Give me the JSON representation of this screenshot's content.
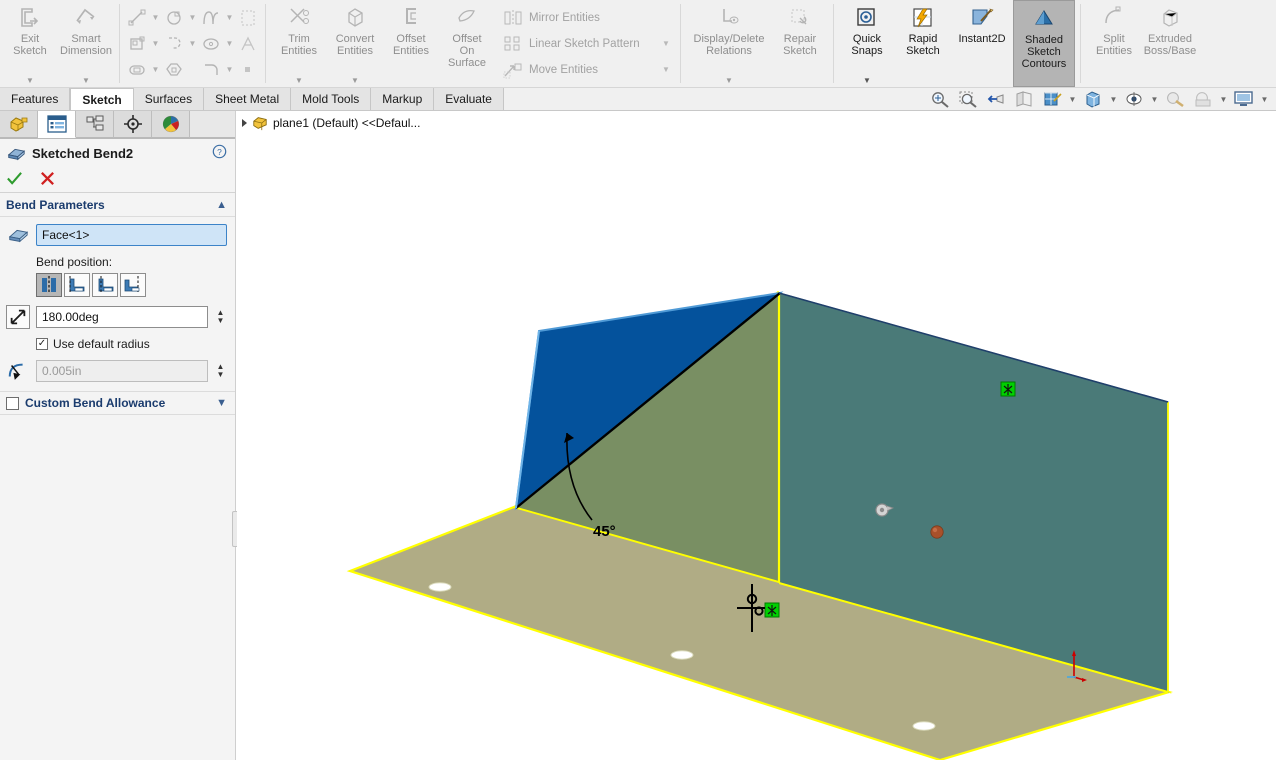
{
  "ribbon": {
    "groups": [
      {
        "name": "sketch-mode",
        "buttons": [
          {
            "label": "Exit\nSketch",
            "icon": "exit-sketch-icon",
            "enabled": false,
            "caret": true
          },
          {
            "label": "Smart\nDimension",
            "icon": "smart-dimension-icon",
            "enabled": false,
            "caret": true
          }
        ]
      },
      {
        "name": "sketch-entities",
        "grid": [
          [
            {
              "icon": "line-icon",
              "caret": true
            },
            {
              "icon": "rectangle-icon",
              "caret": true
            },
            {
              "icon": "spline-icon",
              "caret": true
            },
            {
              "icon": "pattern-icon",
              "caret": false
            }
          ],
          [
            {
              "icon": "corner-rectangle-icon",
              "caret": true
            },
            {
              "icon": "arc-icon",
              "caret": true
            },
            {
              "icon": "ellipse-icon",
              "caret": true
            },
            {
              "icon": "text-icon",
              "caret": false
            }
          ],
          [
            {
              "icon": "slot-icon",
              "caret": true
            },
            {
              "icon": "polygon-icon",
              "caret": false
            },
            {
              "icon": "fillet-icon",
              "caret": true
            },
            {
              "icon": "point-icon",
              "caret": false
            }
          ]
        ]
      },
      {
        "name": "sketch-tools",
        "buttons": [
          {
            "label": "Trim\nEntities",
            "icon": "trim-entities-icon",
            "enabled": false,
            "caret": true
          },
          {
            "label": "Convert\nEntities",
            "icon": "convert-entities-icon",
            "enabled": false,
            "caret": true
          },
          {
            "label": "Offset\nEntities",
            "icon": "offset-entities-icon",
            "enabled": false,
            "caret": false
          },
          {
            "label": "Offset\nOn\nSurface",
            "icon": "offset-on-surface-icon",
            "enabled": false,
            "caret": false
          }
        ]
      },
      {
        "name": "sketch-pattern",
        "textrows": [
          {
            "label": "Mirror Entities",
            "icon": "mirror-entities-icon",
            "caret": false
          },
          {
            "label": "Linear Sketch Pattern",
            "icon": "linear-sketch-pattern-icon",
            "caret": true
          },
          {
            "label": "Move Entities",
            "icon": "move-entities-icon",
            "caret": true
          }
        ]
      },
      {
        "name": "relations",
        "buttons": [
          {
            "label": "Display/Delete\nRelations",
            "icon": "display-delete-relations-icon",
            "enabled": false,
            "caret": true,
            "wide": true
          },
          {
            "label": "Repair\nSketch",
            "icon": "repair-sketch-icon",
            "enabled": false,
            "caret": false
          }
        ]
      },
      {
        "name": "sketch-options",
        "buttons": [
          {
            "label": "Quick\nSnaps",
            "icon": "quick-snaps-icon",
            "enabled": true,
            "caret": true
          },
          {
            "label": "Rapid\nSketch",
            "icon": "rapid-sketch-icon",
            "enabled": true,
            "caret": false
          },
          {
            "label": "Instant2D",
            "icon": "instant2d-icon",
            "enabled": true,
            "caret": false
          },
          {
            "label": "Shaded\nSketch\nContours",
            "icon": "shaded-sketch-contours-icon",
            "enabled": true,
            "caret": false,
            "active": true
          }
        ]
      },
      {
        "name": "misc",
        "buttons": [
          {
            "label": "Split\nEntities",
            "icon": "split-entities-icon",
            "enabled": false,
            "caret": false
          },
          {
            "label": "Extruded\nBoss/Base",
            "icon": "extruded-boss-base-icon",
            "enabled": false,
            "caret": false
          }
        ]
      }
    ]
  },
  "tabs": {
    "items": [
      {
        "label": "Features",
        "selected": false
      },
      {
        "label": "Sketch",
        "selected": true
      },
      {
        "label": "Surfaces",
        "selected": false
      },
      {
        "label": "Sheet Metal",
        "selected": false
      },
      {
        "label": "Mold Tools",
        "selected": false
      },
      {
        "label": "Markup",
        "selected": false
      },
      {
        "label": "Evaluate",
        "selected": false
      }
    ],
    "heads_up": [
      {
        "name": "zoom-to-fit-icon",
        "caret": false
      },
      {
        "name": "zoom-to-area-icon",
        "caret": false
      },
      {
        "name": "previous-view-icon",
        "caret": false
      },
      {
        "name": "section-view-icon",
        "caret": false
      },
      {
        "name": "view-orientation-icon",
        "caret": false
      },
      {
        "name": "display-style-icon",
        "caret": true
      },
      {
        "name": "hide-show-items-icon",
        "caret": true
      },
      {
        "name": "edit-appearance-icon",
        "caret": true
      },
      {
        "name": "apply-scene-icon",
        "caret": false
      },
      {
        "name": "view-settings-icon",
        "caret": true
      },
      {
        "name": "display-monitor-icon",
        "caret": true
      }
    ]
  },
  "property_manager": {
    "tabs": [
      {
        "name": "feature-manager-tab",
        "icon": "feature-tree-icon",
        "selected": false
      },
      {
        "name": "property-manager-tab",
        "icon": "property-list-icon",
        "selected": true
      },
      {
        "name": "configuration-manager-tab",
        "icon": "configuration-icon",
        "selected": false
      },
      {
        "name": "dimxpert-manager-tab",
        "icon": "dimxpert-icon",
        "selected": false
      },
      {
        "name": "display-manager-tab",
        "icon": "display-palette-icon",
        "selected": false
      }
    ],
    "title": "Sketched Bend2",
    "title_icon": "sketched-bend-icon",
    "help_icon": "help-question-icon",
    "ok_label": "OK",
    "cancel_label": "Cancel",
    "section": {
      "title": "Bend Parameters",
      "collapse_icon": "chevron-up-icon",
      "selection_icon": "face-selection-icon",
      "selection_value": "Face<1>",
      "bend_position_label": "Bend position:",
      "bend_position_options": [
        {
          "name": "bend-centerline",
          "selected": true
        },
        {
          "name": "bend-outside",
          "selected": false
        },
        {
          "name": "bend-inside",
          "selected": false
        },
        {
          "name": "material-inside",
          "selected": false
        }
      ],
      "angle_icon": "bend-angle-icon",
      "angle_value": "180.00deg",
      "use_default_radius_label": "Use default radius",
      "use_default_radius_checked": true,
      "radius_icon": "bend-radius-icon",
      "radius_value": "0.005in",
      "radius_disabled": true
    },
    "custom_bend_allowance": {
      "label": "Custom Bend Allowance",
      "checked": false,
      "chevron_icon": "chevron-down-icon"
    }
  },
  "graphics": {
    "tree_item": {
      "label": "plane1 (Default) <<Defaul...",
      "icon": "part-document-icon",
      "expander": "expand-triangle-icon"
    },
    "annotations": {
      "angle_dimension": "45°"
    },
    "colors": {
      "sketch_contour_blue": "#04529C",
      "face_olive": "#798F63",
      "face_teal": "#4A7A78",
      "plate_khaki": "#B0AC85",
      "edge_yellow": "#FFFF00",
      "origin_red": "#CC0000"
    }
  }
}
